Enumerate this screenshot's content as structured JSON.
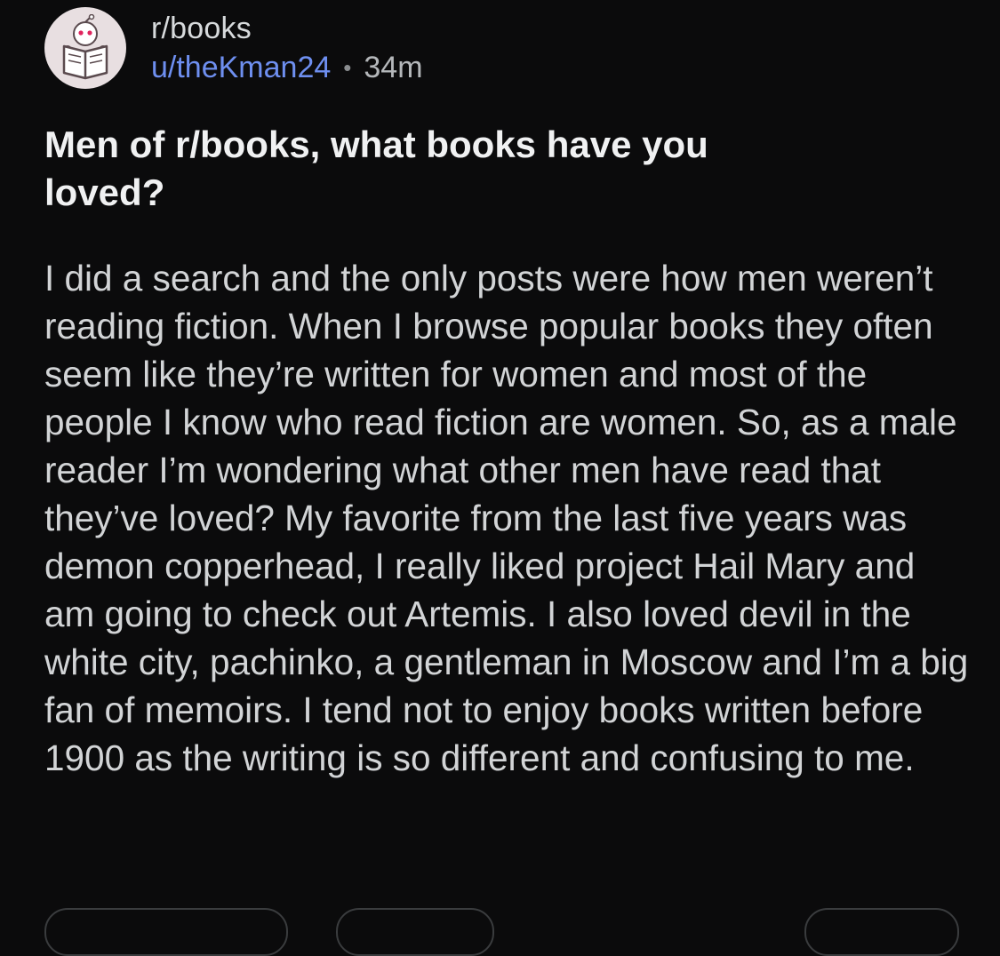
{
  "post": {
    "subreddit": "r/books",
    "author": "u/theKman24",
    "separator": "•",
    "age": "34m",
    "title": "Men of r/books, what books have you loved?",
    "body": "I did a search and the only posts were how men weren’t reading fiction. When I browse popular books they often seem like they’re written for women and most of the people I know who read fiction are women. So, as a male reader I’m wondering what other men have read that they’ve loved? My favorite from the last five years was demon copperhead, I really liked project Hail Mary and am going to check out Artemis. I also loved devil in the white city, pachinko, a gentleman in Moscow and I’m a big fan of memoirs. I tend not to enjoy books written before 1900 as the writing is so different and confusing to me."
  },
  "icons": {
    "avatar": "subreddit-book-snoo-icon"
  },
  "colors": {
    "background": "#0b0b0c",
    "text": "#d2d4d6",
    "title": "#f0f1f2",
    "username": "#6e8ff0",
    "avatar_bg": "#e8dfe1",
    "snoo_eyes": "#e0245e"
  }
}
